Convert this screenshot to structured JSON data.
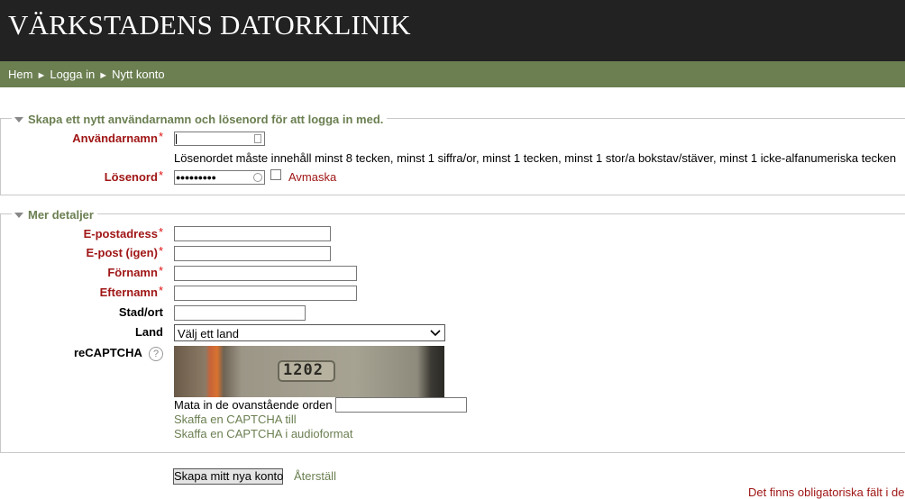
{
  "site": {
    "title": "VÄRKSTADENS DATORKLINIK"
  },
  "breadcrumb": {
    "home": "Hem",
    "login": "Logga in",
    "current": "Nytt konto",
    "separator": "►"
  },
  "section_account": {
    "legend": "Skapa ett nytt användarnamn och lösenord för att logga in med.",
    "username_label": "Användarnamn",
    "password_hint": "Lösenordet måste innehåll minst 8 tecken, minst 1 siffra/or, minst 1 tecken, minst 1 stor/a bokstav/stäver, minst 1 icke-alfanumeriska tecken",
    "password_label": "Lösenord",
    "password_mask": "●●●●●●●●●",
    "unmask_label": "Avmaska"
  },
  "section_details": {
    "legend": "Mer detaljer",
    "email_label": "E-postadress",
    "email2_label": "E-post (igen)",
    "firstname_label": "Förnamn",
    "lastname_label": "Efternamn",
    "city_label": "Stad/ort",
    "country_label": "Land",
    "country_selected": "Välj ett land",
    "recaptcha_label": "reCAPTCHA",
    "captcha_number": "1202",
    "captcha_prompt": "Mata in de ovanstående orden",
    "captcha_new": "Skaffa en CAPTCHA till",
    "captcha_audio": "Skaffa en CAPTCHA i audioformat"
  },
  "actions": {
    "submit": "Skapa mitt nya konto",
    "reset": "Återställ"
  },
  "required_note": "Det finns obligatoriska fält i de",
  "required_star": "*"
}
